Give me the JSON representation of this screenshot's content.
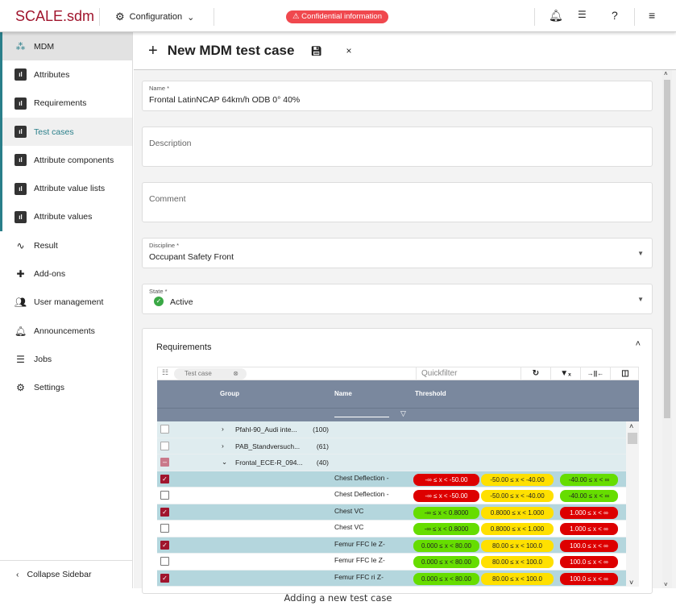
{
  "topbar": {
    "logo": "SCALE.sdm",
    "config": "Configuration",
    "banner": "Confidential information",
    "icons": [
      "bell-icon",
      "tasklist-icon",
      "help-icon",
      "menu-icon"
    ]
  },
  "sidebar": {
    "items": [
      {
        "label": "MDM",
        "icon": "hierarchy-icon"
      },
      {
        "label": "Attributes",
        "icon": "bar-chart-icon"
      },
      {
        "label": "Requirements",
        "icon": "bar-chart-icon"
      },
      {
        "label": "Test cases",
        "icon": "bar-chart-icon"
      },
      {
        "label": "Attribute components",
        "icon": "bar-chart-icon"
      },
      {
        "label": "Attribute value lists",
        "icon": "bar-chart-icon"
      },
      {
        "label": "Attribute values",
        "icon": "bar-chart-icon"
      },
      {
        "label": "Result",
        "icon": "waveform-icon"
      },
      {
        "label": "Add-ons",
        "icon": "puzzle-icon"
      },
      {
        "label": "User management",
        "icon": "users-icon"
      },
      {
        "label": "Announcements",
        "icon": "bell-icon"
      },
      {
        "label": "Jobs",
        "icon": "tasklist-icon"
      },
      {
        "label": "Settings",
        "icon": "gears-icon"
      }
    ],
    "collapse": "Collapse Sidebar"
  },
  "header": {
    "title": "New MDM test case"
  },
  "form": {
    "name_label": "Name *",
    "name_value": "Frontal LatinNCAP 64km/h ODB 0° 40%",
    "description_placeholder": "Description",
    "comment_placeholder": "Comment",
    "discipline_label": "Discipline *",
    "discipline_value": "Occupant Safety Front",
    "state_label": "State *",
    "state_value": "Active"
  },
  "requirements": {
    "title": "Requirements",
    "group_chip": "Test case",
    "quickfilter_placeholder": "Quickfilter",
    "columns": [
      "Group",
      "Name",
      "Threshold"
    ],
    "groups": [
      {
        "name": "Pfahl-90_Audi inte...",
        "count": "(100)",
        "state": "unchecked",
        "expanded": false
      },
      {
        "name": "PAB_Standversuch...",
        "count": "(61)",
        "state": "unchecked",
        "expanded": false
      },
      {
        "name": "Frontal_ECE-R_094...",
        "count": "(40)",
        "state": "indeterminate",
        "expanded": true
      }
    ],
    "rows": [
      {
        "checked": true,
        "name": "Chest Deflection -",
        "thresholds": [
          [
            "-∞ ≤ x < -50.00",
            "red"
          ],
          [
            "-50.00 ≤ x < -40.00",
            "yellow"
          ],
          [
            "-40.00 ≤ x < ∞",
            "green"
          ]
        ]
      },
      {
        "checked": false,
        "name": "Chest Deflection -",
        "thresholds": [
          [
            "-∞ ≤ x < -50.00",
            "red"
          ],
          [
            "-50.00 ≤ x < -40.00",
            "yellow"
          ],
          [
            "-40.00 ≤ x < ∞",
            "green"
          ]
        ]
      },
      {
        "checked": true,
        "name": "Chest VC",
        "thresholds": [
          [
            "-∞ ≤ x < 0.8000",
            "green"
          ],
          [
            "0.8000 ≤ x < 1.000",
            "yellow"
          ],
          [
            "1.000 ≤ x < ∞",
            "red"
          ]
        ]
      },
      {
        "checked": false,
        "name": "Chest VC",
        "thresholds": [
          [
            "-∞ ≤ x < 0.8000",
            "green"
          ],
          [
            "0.8000 ≤ x < 1.000",
            "yellow"
          ],
          [
            "1.000 ≤ x < ∞",
            "red"
          ]
        ]
      },
      {
        "checked": true,
        "name": "Femur FFC le Z-",
        "thresholds": [
          [
            "0.000 ≤ x < 80.00",
            "green"
          ],
          [
            "80.00 ≤ x < 100.0",
            "yellow"
          ],
          [
            "100.0 ≤ x < ∞",
            "red"
          ]
        ]
      },
      {
        "checked": false,
        "name": "Femur FFC le Z-",
        "thresholds": [
          [
            "0.000 ≤ x < 80.00",
            "green"
          ],
          [
            "80.00 ≤ x < 100.0",
            "yellow"
          ],
          [
            "100.0 ≤ x < ∞",
            "red"
          ]
        ]
      },
      {
        "checked": true,
        "name": "Femur FFC ri Z-",
        "thresholds": [
          [
            "0.000 ≤ x < 80.00",
            "green"
          ],
          [
            "80.00 ≤ x < 100.0",
            "yellow"
          ],
          [
            "100.0 ≤ x < ∞",
            "red"
          ]
        ]
      }
    ]
  },
  "caption": "Adding a new test case",
  "colors": {
    "brand": "#a0152d",
    "accent": "#2a7f8a",
    "banner": "#f0484e",
    "header": "#7a889e",
    "red": "#dd0000",
    "yellow": "#ffe000",
    "green": "#66dd00"
  }
}
